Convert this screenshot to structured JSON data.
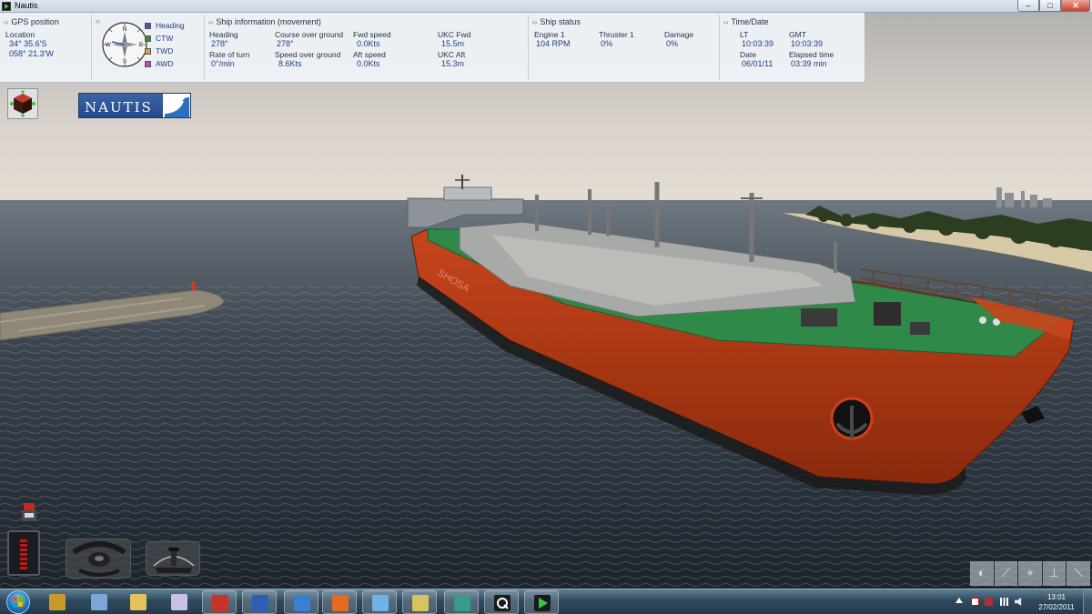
{
  "window": {
    "title": "Nautis",
    "min": "–",
    "max": "□",
    "close": "✕"
  },
  "gps": {
    "title": "GPS position",
    "location_label": "Location",
    "lat": "34° 35.6'S",
    "lon": "058° 21.3'W"
  },
  "compass": {
    "points": {
      "n": "N",
      "e": "E",
      "s": "S",
      "w": "W"
    },
    "legend": [
      {
        "label": "Heading",
        "color": "#4b4fb8"
      },
      {
        "label": "CTW",
        "color": "#3a8a3a"
      },
      {
        "label": "TWD",
        "color": "#e0a030"
      },
      {
        "label": "AWD",
        "color": "#d040c0"
      }
    ]
  },
  "movement": {
    "title": "Ship information (movement)",
    "heading_label": "Heading",
    "heading": "278°",
    "cog_label": "Course over ground",
    "cog": "278°",
    "fwd_speed_label": "Fwd speed",
    "fwd_speed": "0.0Kts",
    "ukc_fwd_label": "UKC Fwd",
    "ukc_fwd": "15.5m",
    "rot_label": "Rate of turn",
    "rot": "0°/min",
    "sog_label": "Speed over ground",
    "sog": "8.6Kts",
    "aft_speed_label": "Aft speed",
    "aft_speed": "0.0Kts",
    "ukc_aft_label": "UKC Aft",
    "ukc_aft": "15.3m"
  },
  "status": {
    "title": "Ship status",
    "engine_label": "Engine 1",
    "engine": "104 RPM",
    "thruster_label": "Thruster 1",
    "thruster": "0%",
    "damage_label": "Damage",
    "damage": "0%"
  },
  "time": {
    "title": "Time/Date",
    "lt_label": "LT",
    "lt": "10:03:39",
    "gmt_label": "GMT",
    "gmt": "10:03:39",
    "date_label": "Date",
    "date": "06/01/11",
    "elapsed_label": "Elapsed time",
    "elapsed": "03:39 min"
  },
  "logo": {
    "text": "NAUTIS"
  },
  "ship": {
    "hull_name": "SHOSA"
  },
  "taskbar": {
    "items": [
      {
        "name": "taskbar-start-app-1",
        "color": "#c89a2a"
      },
      {
        "name": "taskbar-calculator",
        "color": "#7aa7d6"
      },
      {
        "name": "taskbar-explorer",
        "color": "#e3c25a"
      },
      {
        "name": "taskbar-paint",
        "color": "#c9c0e8"
      },
      {
        "name": "taskbar-acrobat",
        "color": "#c8322b"
      },
      {
        "name": "taskbar-word",
        "color": "#2f5fb0"
      },
      {
        "name": "taskbar-thunderbird",
        "color": "#3a7fd0"
      },
      {
        "name": "taskbar-firefox",
        "color": "#e66a1e"
      },
      {
        "name": "taskbar-notes",
        "color": "#6fb2e6"
      },
      {
        "name": "taskbar-connect",
        "color": "#d8c45e"
      },
      {
        "name": "taskbar-g-app",
        "color": "#3a9a8a"
      },
      {
        "name": "taskbar-q-app",
        "color": "#1a1a1a"
      },
      {
        "name": "taskbar-nautis",
        "color": "#1a1a1a"
      }
    ],
    "time": "13:01",
    "date": "27/02/2011"
  }
}
